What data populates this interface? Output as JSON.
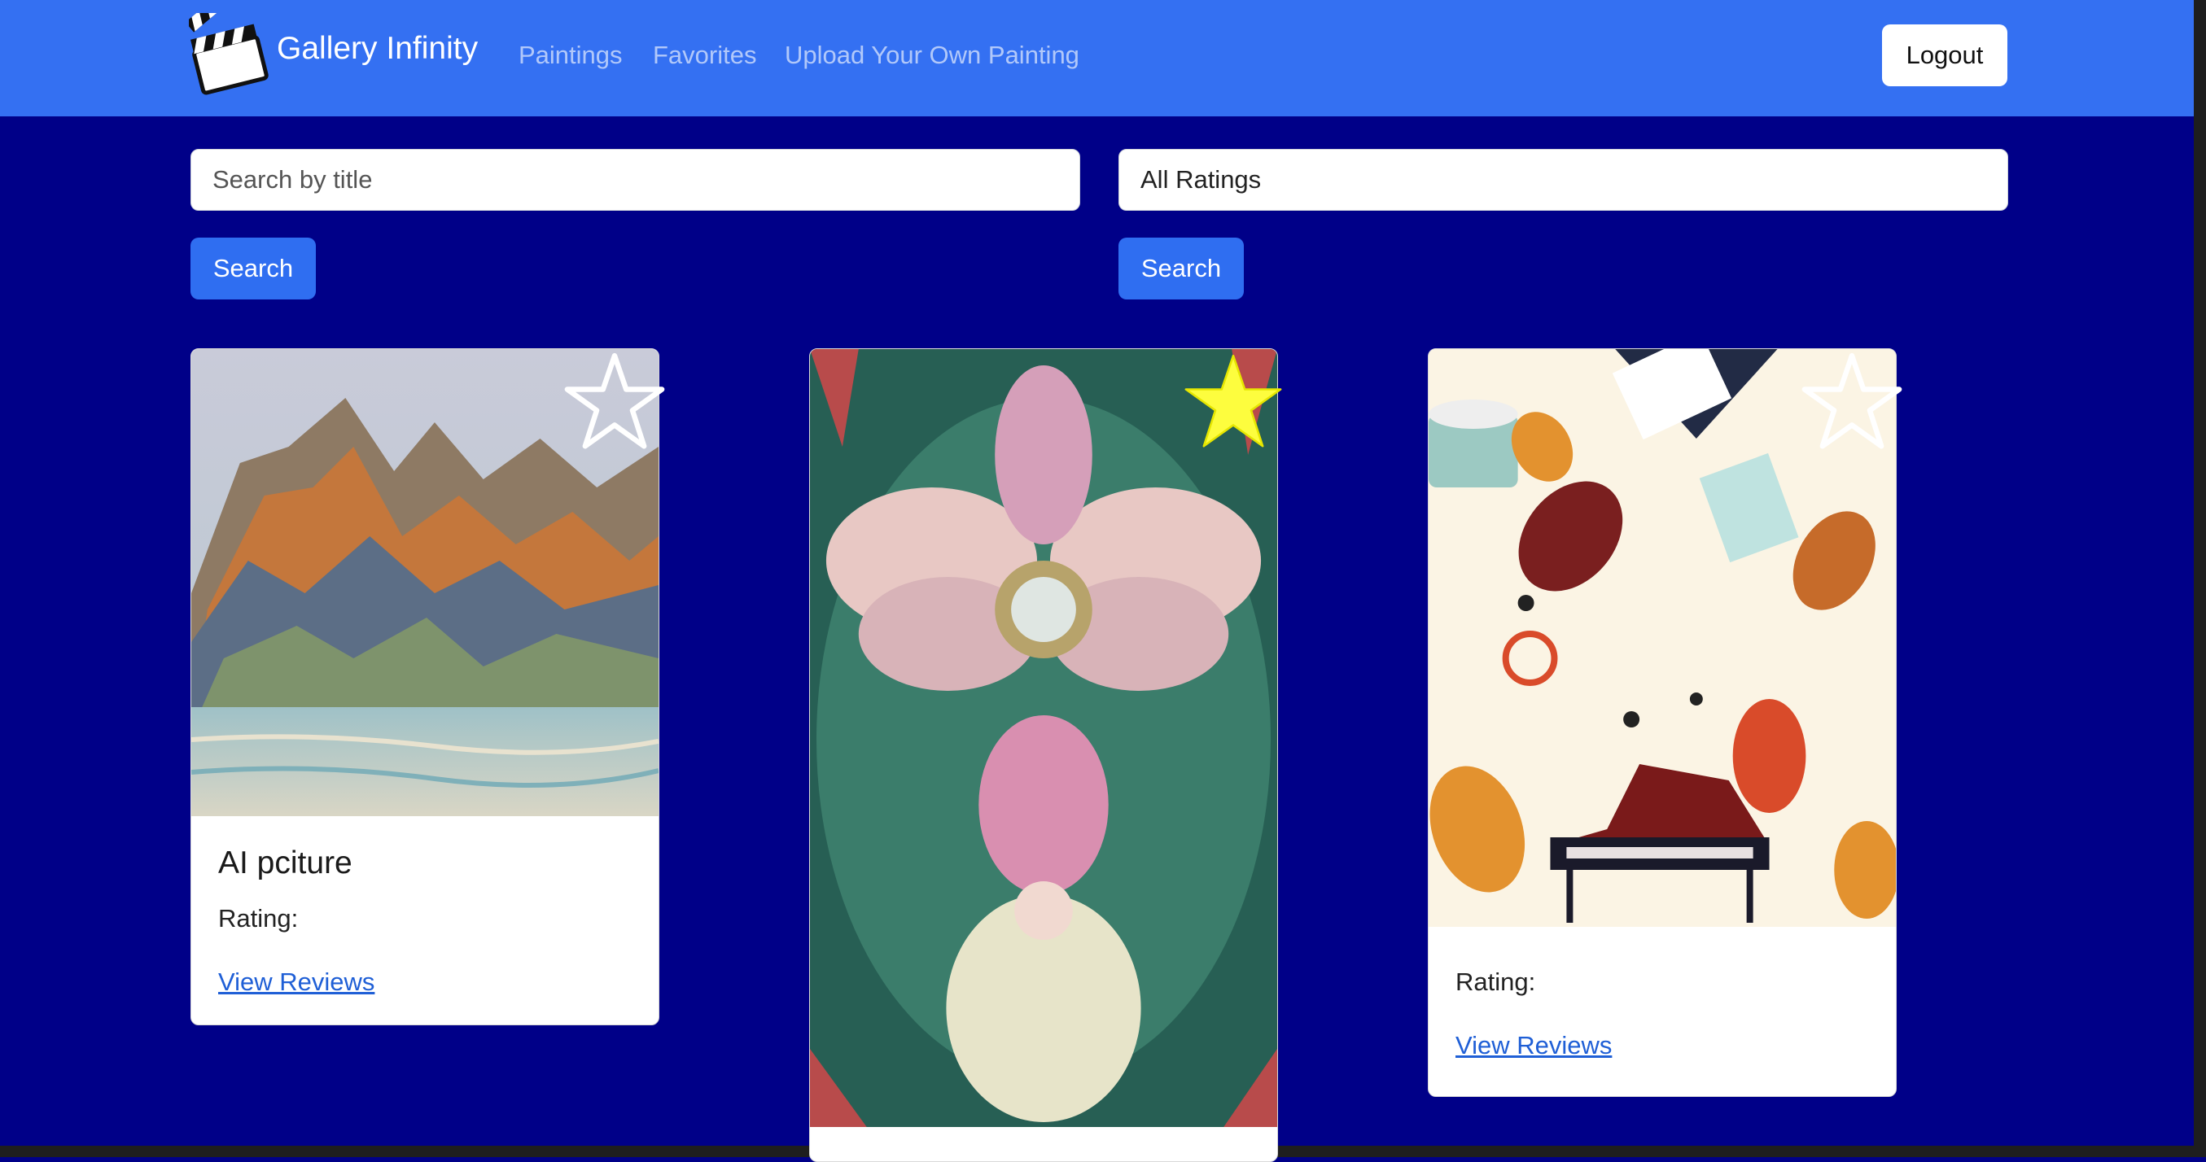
{
  "navbar": {
    "brand": "Gallery Infinity",
    "brand_icon": "clapperboard-icon",
    "links": [
      "Paintings",
      "Favorites",
      "Upload Your Own Painting"
    ],
    "logout_label": "Logout",
    "bg_color": "#3470f2"
  },
  "search": {
    "title_placeholder": "Search by title",
    "rating_selected": "All Ratings",
    "button_label": "Search"
  },
  "cards": [
    {
      "title": "AI pciture",
      "rating_label": "Rating:",
      "reviews_link": "View Reviews",
      "favorite": false,
      "image_description_icon": "mountain-landscape-image"
    },
    {
      "title": "",
      "rating_label": "",
      "reviews_link": "",
      "favorite": true,
      "image_description_icon": "floral-goddess-image"
    },
    {
      "title": "",
      "rating_label": "Rating:",
      "reviews_link": "View Reviews",
      "favorite": false,
      "image_description_icon": "musical-instruments-image"
    }
  ],
  "colors": {
    "page_bg": "#000088",
    "primary": "#2f6ef1",
    "star_filled": "#fdfd3e",
    "link": "#1f5fd6"
  }
}
